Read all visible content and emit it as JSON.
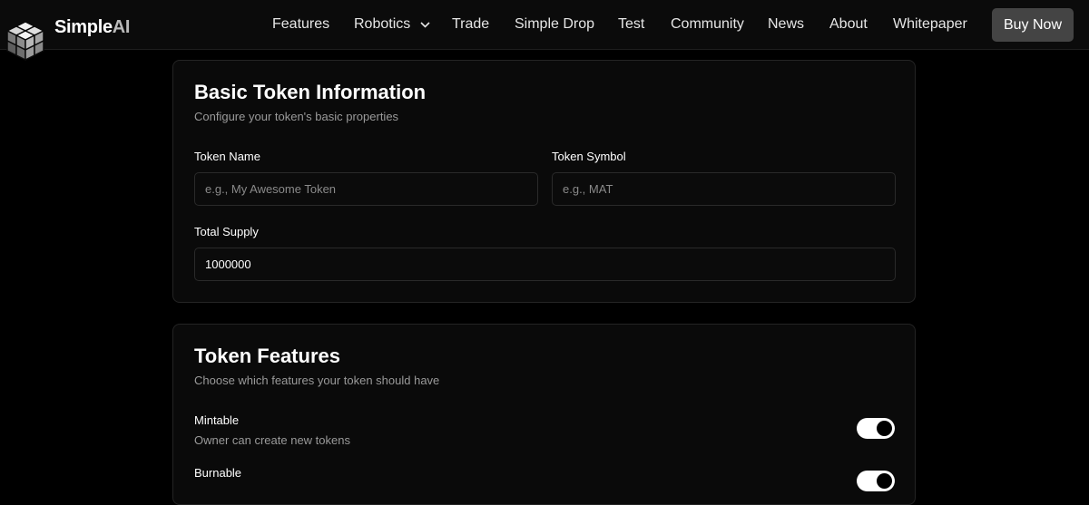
{
  "nav": {
    "brand_main": "Simple",
    "brand_accent": "AI",
    "items": [
      {
        "label": "Features"
      },
      {
        "label": "Robotics",
        "has_dropdown": true
      },
      {
        "label": "Trade"
      },
      {
        "label": "Simple Drop"
      },
      {
        "label": "Test"
      },
      {
        "label": "Community"
      },
      {
        "label": "News"
      },
      {
        "label": "About"
      },
      {
        "label": "Whitepaper"
      }
    ],
    "cta_label": "Buy Now"
  },
  "basic_info": {
    "title": "Basic Token Information",
    "subtitle": "Configure your token's basic properties",
    "token_name": {
      "label": "Token Name",
      "placeholder": "e.g., My Awesome Token",
      "value": ""
    },
    "token_symbol": {
      "label": "Token Symbol",
      "placeholder": "e.g., MAT",
      "value": ""
    },
    "total_supply": {
      "label": "Total Supply",
      "value": "1000000"
    }
  },
  "features": {
    "title": "Token Features",
    "subtitle": "Choose which features your token should have",
    "items": [
      {
        "name": "Mintable",
        "description": "Owner can create new tokens",
        "enabled": true
      },
      {
        "name": "Burnable",
        "enabled": true
      }
    ]
  },
  "colors": {
    "background": "#000000",
    "card": "#0a0a0a",
    "cta": "#444444",
    "muted_text": "#9a9a9a"
  }
}
